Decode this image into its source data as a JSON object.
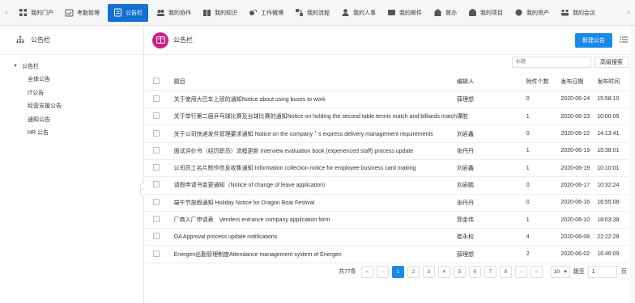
{
  "nav": {
    "items": [
      {
        "label": "我的门户",
        "icon": "grid-icon",
        "active": false
      },
      {
        "label": "考勤管理",
        "icon": "calendar-check-icon",
        "active": false
      },
      {
        "label": "公告栏",
        "icon": "notice-icon",
        "active": true
      },
      {
        "label": "我的协作",
        "icon": "collaboration-icon",
        "active": false
      },
      {
        "label": "我的知识",
        "icon": "book-icon",
        "active": false
      },
      {
        "label": "工作微博",
        "icon": "microblog-icon",
        "active": false
      },
      {
        "label": "我的流程",
        "icon": "workflow-icon",
        "active": false
      },
      {
        "label": "我的人事",
        "icon": "user-icon",
        "active": false
      },
      {
        "label": "我的邮件",
        "icon": "mail-icon",
        "active": false
      },
      {
        "label": "督办",
        "icon": "supervise-icon",
        "active": false
      },
      {
        "label": "我的项目",
        "icon": "project-icon",
        "active": false
      },
      {
        "label": "我的资产",
        "icon": "asset-icon",
        "active": false
      },
      {
        "label": "我的会议",
        "icon": "meeting-icon",
        "active": false
      }
    ]
  },
  "sidebar": {
    "title": "公告栏",
    "root": "公告栏",
    "children": [
      "全体公告",
      "IT公告",
      "经营支援公告",
      "通知公告",
      "HR 公告"
    ]
  },
  "main": {
    "title": "公告栏",
    "new_button": "新建公告",
    "search_placeholder": "标题",
    "advanced_search": "高级搜索",
    "columns": {
      "title": "题目",
      "editor": "编辑人",
      "attachments": "附件个数",
      "date": "发布日期",
      "time": "发布时间"
    },
    "rows": [
      {
        "title": "关于使用大巴车上班的通知Notice about using buses to work",
        "editor": "薛理想",
        "attachments": "0",
        "date": "2020-06-24",
        "time": "15:58:10"
      },
      {
        "title": "关于举行第二届乒乓球比赛及台球比赛的通知Notice on holding the second table tennis match and billiards match",
        "editor": "谭胜",
        "attachments": "1",
        "date": "2020-06-23",
        "time": "10:00:05"
      },
      {
        "title": "关于公司快递发件管理要求通知 Notice on the company＇s express delivery management requirements",
        "editor": "刘岩鑫",
        "attachments": "0",
        "date": "2020-06-22",
        "time": "14:13:41"
      },
      {
        "title": "面试评价书（经历职员）流程更新 Interview evaluation book (experienced staff) process update",
        "editor": "张丹丹",
        "attachments": "1",
        "date": "2020-06-19",
        "time": "15:38:01"
      },
      {
        "title": "公司员工名片制作信息收集通知 Information collection notice for employee business card making",
        "editor": "刘岩鑫",
        "attachments": "1",
        "date": "2020-06-19",
        "time": "10:10:01"
      },
      {
        "title": "请假申请书变更通知（Notice of change of leave application）",
        "editor": "刘岩鹏",
        "attachments": "0",
        "date": "2020-06-17",
        "time": "10:32:24"
      },
      {
        "title": "端午节放假通知 Holiday Notice for Dragon Boat Festival",
        "editor": "张丹丹",
        "attachments": "0",
        "date": "2020-06-16",
        "time": "16:55:08"
      },
      {
        "title": "厂商入厂申请表　Venders entrance company application form",
        "editor": "郭金伟",
        "attachments": "1",
        "date": "2020-06-10",
        "time": "18:03:38"
      },
      {
        "title": "OA Approval process update notifications",
        "editor": "崔永权",
        "attachments": "4",
        "date": "2020-06-08",
        "time": "22:22:28"
      },
      {
        "title": "Energen出勤管理制度Attendance management system of Energen",
        "editor": "薛理想",
        "attachments": "2",
        "date": "2020-06-02",
        "time": "16:46:09"
      }
    ]
  },
  "pagination": {
    "total": "共77条",
    "pages": [
      "1",
      "2",
      "3",
      "4",
      "5",
      "6",
      "7",
      "8"
    ],
    "current": "1",
    "page_size": "10",
    "jump_label": "跳至",
    "jump_value": "1",
    "page_suffix": "页"
  },
  "colors": {
    "accent": "#1570d4",
    "button": "#1a8ae8",
    "logo": "#c71f85"
  }
}
